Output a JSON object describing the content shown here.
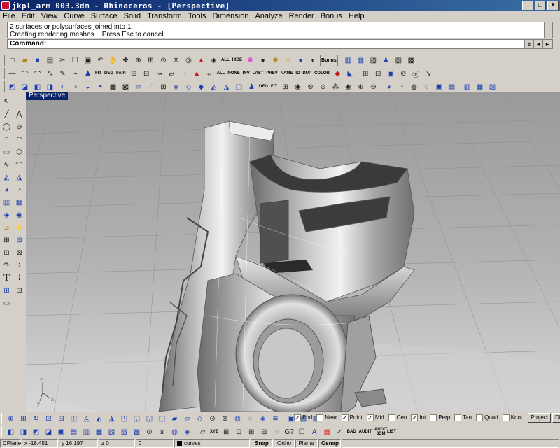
{
  "window": {
    "title": "jkpl_arm 003.3dm - Rhinoceros - [Perspective]",
    "min": "_",
    "max": "□",
    "close": "×"
  },
  "menu": [
    "File",
    "Edit",
    "View",
    "Curve",
    "Surface",
    "Solid",
    "Transform",
    "Tools",
    "Dimension",
    "Analyze",
    "Render",
    "Bonus",
    "Help"
  ],
  "command": {
    "history": [
      "2 surfaces or polysurfaces joined into 1.",
      "Creating rendering meshes... Press Esc to cancel"
    ],
    "prompt": "Command:",
    "input": ""
  },
  "toolbar1": {
    "icons": [
      "new-icon",
      "open-icon",
      "save-icon",
      "print-icon",
      "cut-icon",
      "copy-icon",
      "paste-icon",
      "undo-icon",
      "pan-icon",
      "rotate-view-icon",
      "zoom-icon",
      "zoom-window-icon",
      "zoom-extents-icon",
      "zoom-selected-icon",
      "zoom-target-icon",
      "car-render-icon",
      "render-preview-icon"
    ],
    "text_buttons": [
      "ALL",
      "HIDE"
    ],
    "icons2": [
      "color-wheel-icon",
      "render-sphere-icon",
      "light-bulb-icon",
      "sun-icon",
      "render-ball-icon",
      "material-icon"
    ],
    "bonus": "Bonus",
    "icons3": [
      "layer-icon",
      "properties-icon",
      "object-info-icon",
      "person-icon",
      "measure-icon",
      "options-icon"
    ]
  },
  "toolbar2": {
    "icons": [
      "line-icon",
      "arc-icon",
      "arc2-icon",
      "curve-icon",
      "pencil-icon",
      "edit-point-icon",
      "analyze-icon"
    ],
    "text_buttons": [
      "FIT",
      "DEG",
      "FAIR",
      "ALL",
      "NONE",
      "INV",
      "LAST",
      "PREV",
      "NAME",
      "ID",
      "DUP",
      "COLOR"
    ]
  },
  "toolbar3": {
    "icons": [
      "surface-icon",
      "loft-icon",
      "network-icon",
      "sweep-icon",
      "revolve-icon",
      "blend-icon",
      "trim-icon",
      "split-icon",
      "grid-icon",
      "boolean-icon",
      "plane-icon",
      "fillet-icon",
      "extend-icon",
      "offset-icon",
      "match-icon",
      "merge-icon",
      "rebuild-icon"
    ],
    "text_buttons": [
      "DEG",
      "FIT"
    ]
  },
  "viewport": {
    "label": "Perspective",
    "axis_x": "x",
    "axis_y": "y",
    "axis_z": "z"
  },
  "osnap": {
    "items": [
      {
        "label": "End",
        "checked": true
      },
      {
        "label": "Near",
        "checked": false
      },
      {
        "label": "Point",
        "checked": true
      },
      {
        "label": "Mid",
        "checked": true
      },
      {
        "label": "Cen",
        "checked": false
      },
      {
        "label": "Int",
        "checked": true
      },
      {
        "label": "Perp",
        "checked": false
      },
      {
        "label": "Tan",
        "checked": false
      },
      {
        "label": "Quad",
        "checked": false
      },
      {
        "label": "Knot",
        "checked": false
      }
    ],
    "project": "Project",
    "disable": "Disable"
  },
  "bottom_text": [
    "XYZ",
    "BAD",
    "AUDIT",
    "AUDIT 3DM",
    "LIST"
  ],
  "status": {
    "cplane": "CPlane",
    "x": "x -18.451",
    "y": "y 16.197",
    "z": "z 0",
    "val": "0",
    "layer": "curves",
    "snap": "Snap",
    "ortho": "Ortho",
    "planar": "Planar",
    "osnap": "Osnap"
  }
}
